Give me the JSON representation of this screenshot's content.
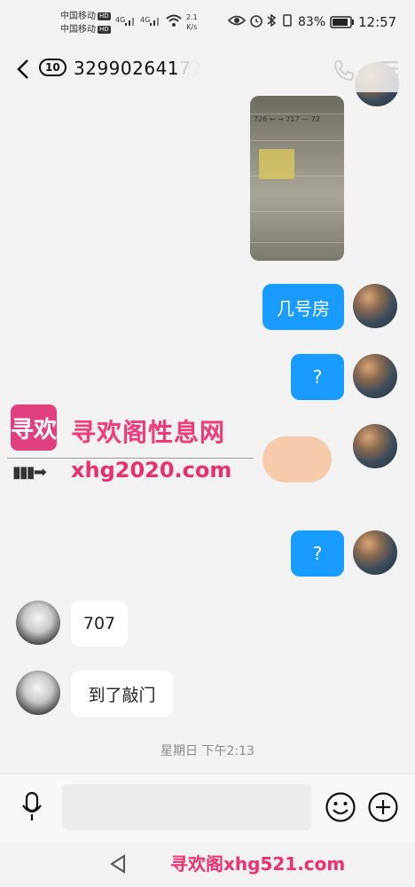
{
  "status_bar": {
    "carrier1": "中国移动",
    "carrier2": "中国移动",
    "hd": "HD",
    "net1": "4G",
    "net2": "4G",
    "speed_value": "2.1",
    "speed_unit": "K/s",
    "battery": "83%",
    "time": "12:57"
  },
  "header": {
    "back_count": "10",
    "contact_id": "3299026417"
  },
  "messages": {
    "out_1": "几号房",
    "out_2": "?",
    "out_3": "?",
    "in_1": "707",
    "in_2": "到了敲门"
  },
  "photo_text": "726 ← → 717 — 72",
  "timestamp": "星期日 下午2:13",
  "watermark": {
    "logo_text": "寻欢",
    "title": "寻欢阁性息网",
    "url": "xhg2020.com",
    "arrow": "▮▮▮➡",
    "footer": "寻欢阁xhg521.com"
  }
}
